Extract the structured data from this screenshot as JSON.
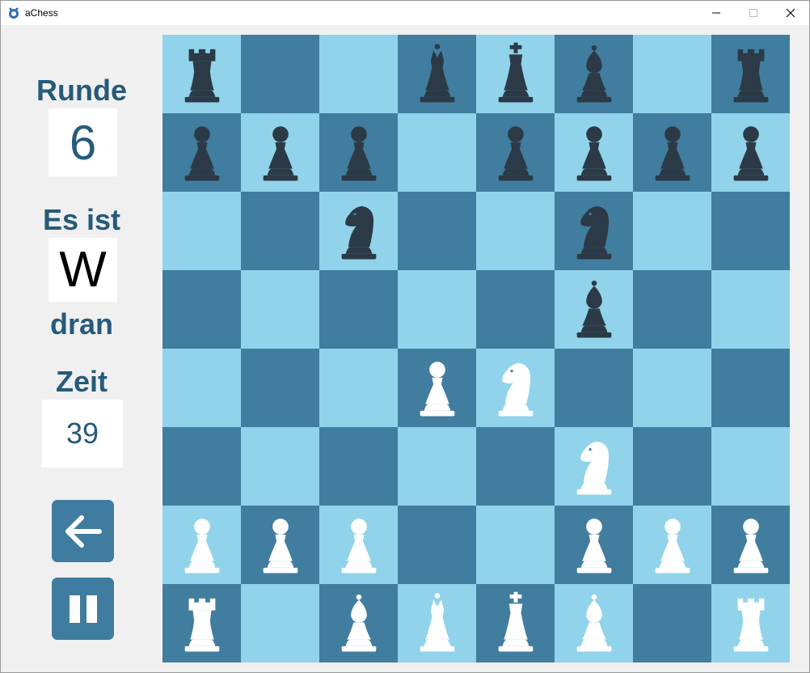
{
  "window": {
    "title": "aChess"
  },
  "sidebar": {
    "round_label": "Runde",
    "round_value": "6",
    "turn_prefix": "Es ist",
    "turn_value": "W",
    "turn_suffix": "dran",
    "time_label": "Zeit",
    "time_value": "39",
    "back_button_icon": "arrow-left-icon",
    "pause_button_icon": "pause-icon"
  },
  "colors": {
    "light_square": "#91d3ea",
    "dark_square": "#417d9f",
    "accent": "#265a7a",
    "button": "#3f7c9f",
    "white_piece": "#ffffff",
    "black_piece": "#2b3a46"
  },
  "board": {
    "rows": [
      [
        "bR",
        "",
        "",
        "bQ",
        "bK",
        "bB",
        "",
        "bR"
      ],
      [
        "bP",
        "bP",
        "bP",
        "",
        "bP",
        "bP",
        "bP",
        "bP"
      ],
      [
        "",
        "",
        "bN",
        "",
        "",
        "bN",
        "",
        ""
      ],
      [
        "",
        "",
        "",
        "",
        "",
        "bB",
        "",
        ""
      ],
      [
        "",
        "",
        "",
        "wP",
        "wN",
        "",
        "",
        ""
      ],
      [
        "",
        "",
        "",
        "",
        "",
        "wN",
        "",
        ""
      ],
      [
        "wP",
        "wP",
        "wP",
        "",
        "",
        "wP",
        "wP",
        "wP"
      ],
      [
        "wR",
        "",
        "wB",
        "wQ",
        "wK",
        "wB",
        "",
        "wR"
      ]
    ]
  }
}
